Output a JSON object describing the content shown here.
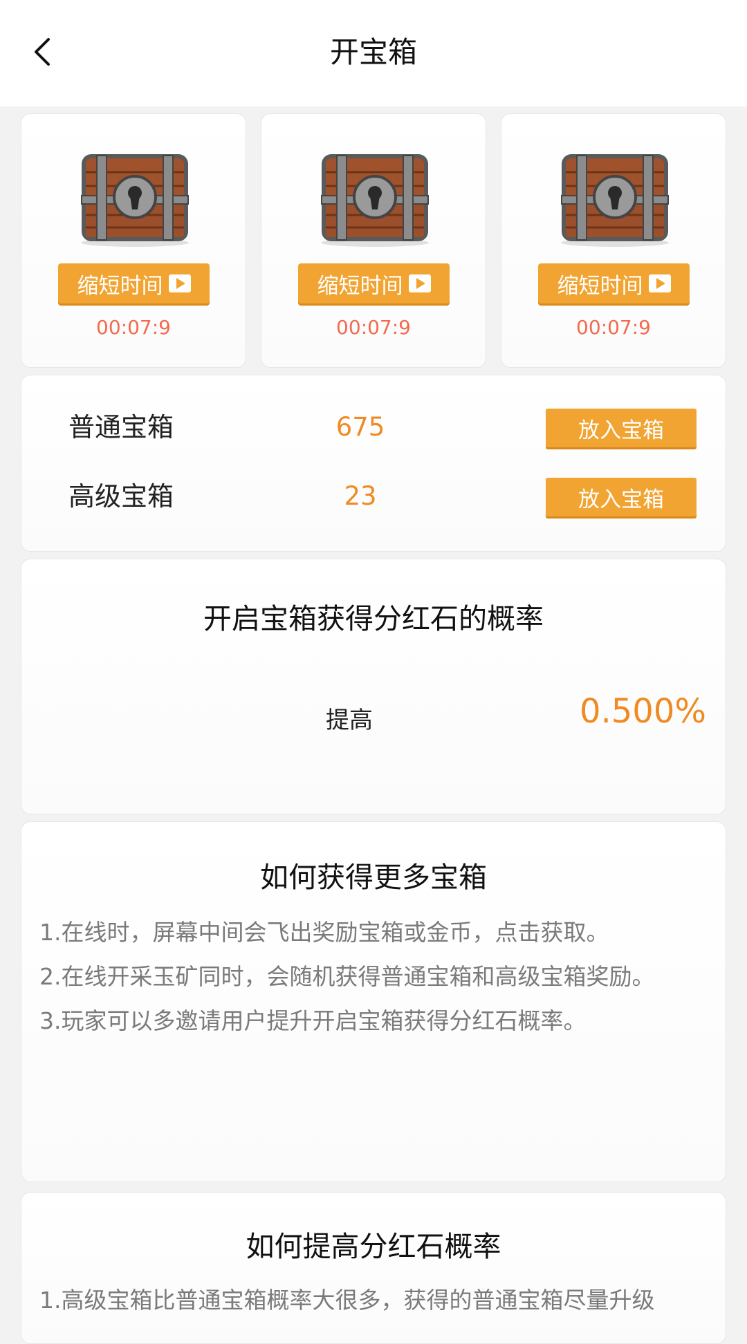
{
  "header": {
    "title": "开宝箱"
  },
  "chests": [
    {
      "button_label": "缩短时间",
      "timer": "00:07:9"
    },
    {
      "button_label": "缩短时间",
      "timer": "00:07:9"
    },
    {
      "button_label": "缩短时间",
      "timer": "00:07:9"
    }
  ],
  "inventory": [
    {
      "name": "普通宝箱",
      "count": "675",
      "button_label": "放入宝箱"
    },
    {
      "name": "高级宝箱",
      "count": "23",
      "button_label": "放入宝箱"
    }
  ],
  "probability": {
    "title": "开启宝箱获得分红石的概率",
    "label": "提高",
    "value": "0.500%"
  },
  "how_to_get": {
    "title": "如何获得更多宝箱",
    "items": [
      "1.在线时，屏幕中间会飞出奖励宝箱或金币，点击获取。",
      "2.在线开采玉矿同时，会随机获得普通宝箱和高级宝箱奖励。",
      "3.玩家可以多邀请用户提升开启宝箱获得分红石概率。"
    ]
  },
  "how_to_improve": {
    "title": "如何提高分红石概率",
    "items": [
      "1.高级宝箱比普通宝箱概率大很多，获得的普通宝箱尽量升级"
    ]
  },
  "colors": {
    "accent": "#f1a431",
    "number": "#f08a22",
    "timer": "#f36a4f"
  }
}
